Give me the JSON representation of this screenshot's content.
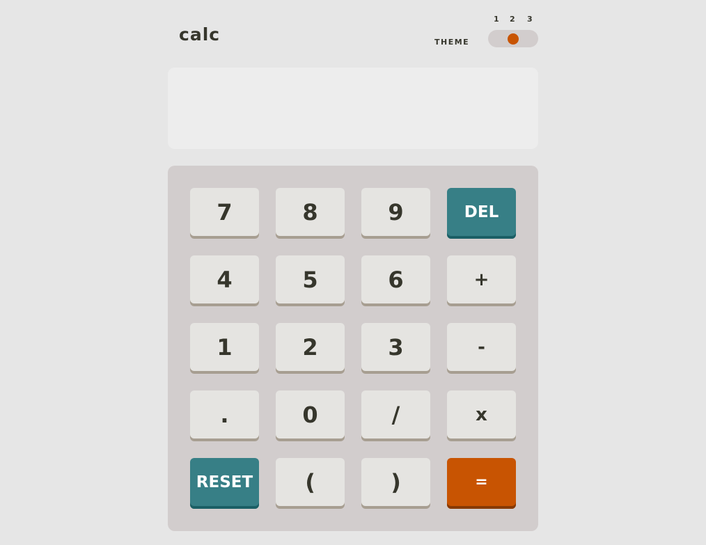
{
  "header": {
    "logo": "calc",
    "theme_label": "THEME",
    "theme_options": [
      "1",
      "2",
      "3"
    ],
    "active_theme": "2"
  },
  "screen": {
    "value": ""
  },
  "keypad": {
    "keys": [
      {
        "label": "7",
        "style": "number"
      },
      {
        "label": "8",
        "style": "number"
      },
      {
        "label": "9",
        "style": "number"
      },
      {
        "label": "DEL",
        "style": "teal"
      },
      {
        "label": "4",
        "style": "number"
      },
      {
        "label": "5",
        "style": "number"
      },
      {
        "label": "6",
        "style": "number"
      },
      {
        "label": "+",
        "style": "operator"
      },
      {
        "label": "1",
        "style": "number"
      },
      {
        "label": "2",
        "style": "number"
      },
      {
        "label": "3",
        "style": "number"
      },
      {
        "label": "-",
        "style": "operator"
      },
      {
        "label": ".",
        "style": "number"
      },
      {
        "label": "0",
        "style": "number"
      },
      {
        "label": "/",
        "style": "number"
      },
      {
        "label": "x",
        "style": "operator"
      },
      {
        "label": "RESET",
        "style": "teal"
      },
      {
        "label": "(",
        "style": "number"
      },
      {
        "label": ")",
        "style": "number"
      },
      {
        "label": "=",
        "style": "orange"
      }
    ]
  },
  "colors": {
    "page_background": "#e6e6e6",
    "keypad_background": "#d2cdcd",
    "screen_background": "#ededed",
    "key_background": "#e5e4e1",
    "key_shadow": "#a79e91",
    "teal_key": "#377f86",
    "teal_shadow": "#1b5f65",
    "equals_key": "#c85402",
    "equals_shadow": "#873901",
    "text_dark": "#36362c"
  }
}
